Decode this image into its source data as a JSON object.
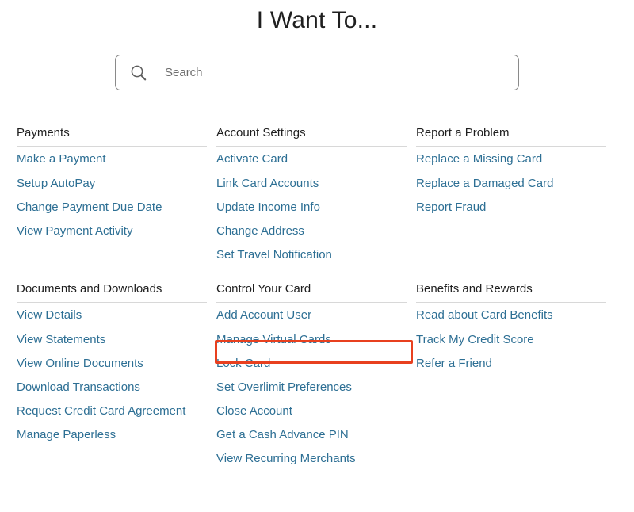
{
  "page": {
    "title": "I Want To..."
  },
  "search": {
    "placeholder": "Search",
    "value": "",
    "icon": "search-icon"
  },
  "highlight": {
    "target_label": "Add Account User",
    "color": "#e8401f"
  },
  "colors": {
    "link": "#2d6f94",
    "header_text": "#1f1f1f",
    "divider": "#d8d8d8",
    "highlight": "#e8401f",
    "background": "#ffffff"
  },
  "groups": [
    {
      "id": "payments",
      "header": "Payments",
      "items": [
        "Make a Payment",
        "Setup AutoPay",
        "Change Payment Due Date",
        "View Payment Activity"
      ]
    },
    {
      "id": "account-settings",
      "header": "Account Settings",
      "items": [
        "Activate Card",
        "Link Card Accounts",
        "Update Income Info",
        "Change Address",
        "Set Travel Notification"
      ]
    },
    {
      "id": "report-a-problem",
      "header": "Report a Problem",
      "items": [
        "Replace a Missing Card",
        "Replace a Damaged Card",
        "Report Fraud"
      ]
    },
    {
      "id": "documents-and-downloads",
      "header": "Documents and Downloads",
      "items": [
        "View Details",
        "View Statements",
        "View Online Documents",
        "Download Transactions",
        "Request Credit Card Agreement",
        "Manage Paperless"
      ]
    },
    {
      "id": "control-your-card",
      "header": "Control Your Card",
      "items": [
        "Add Account User",
        "Manage Virtual Cards",
        "Lock Card",
        "Set Overlimit Preferences",
        "Close Account",
        "Get a Cash Advance PIN",
        "View Recurring Merchants"
      ]
    },
    {
      "id": "benefits-and-rewards",
      "header": "Benefits and Rewards",
      "items": [
        "Read about Card Benefits",
        "Track My Credit Score",
        "Refer a Friend"
      ]
    }
  ]
}
